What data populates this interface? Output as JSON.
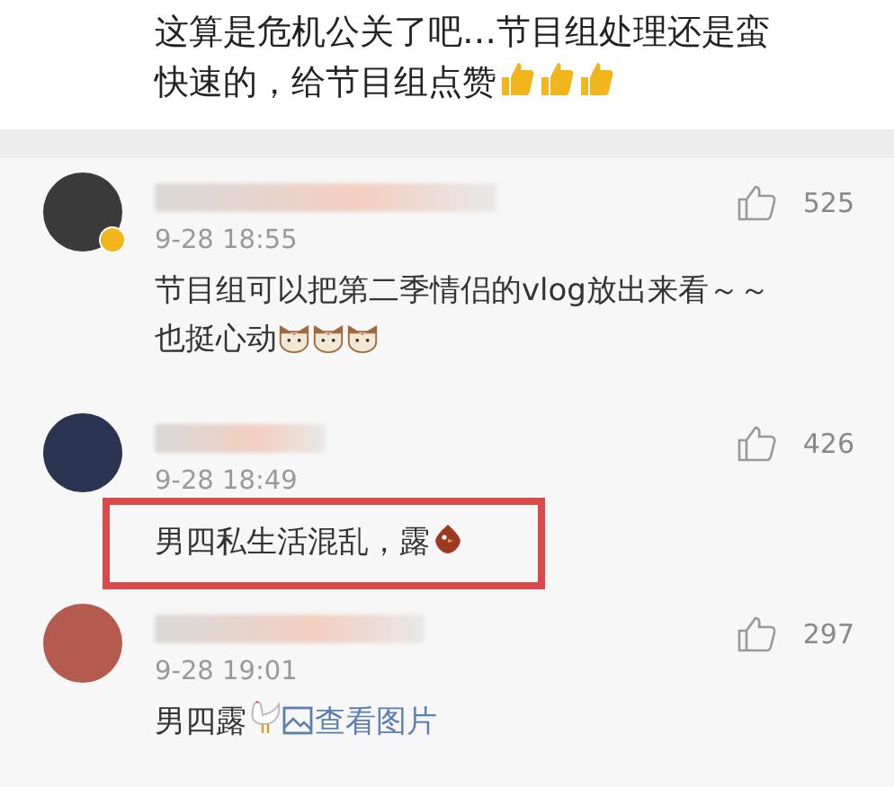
{
  "post": {
    "parts": [
      {
        "kind": "line",
        "text": "这算是危机公关了吧…节目组处理还是蛮"
      },
      {
        "kind": "text",
        "text": "快速的，给节目组点赞"
      },
      {
        "kind": "thumb"
      },
      {
        "kind": "thumb"
      },
      {
        "kind": "thumb"
      }
    ]
  },
  "comments": [
    {
      "verified": true,
      "highlighted": false,
      "time": "9-28 18:55",
      "likes": "525",
      "parts": [
        {
          "kind": "line",
          "text": "节目组可以把第二季情侣的vlog放出来看～～"
        },
        {
          "kind": "text",
          "text": "也挺心动"
        },
        {
          "kind": "cat"
        },
        {
          "kind": "cat"
        },
        {
          "kind": "cat"
        }
      ]
    },
    {
      "verified": false,
      "highlighted": true,
      "time": "9-28 18:49",
      "likes": "426",
      "parts": [
        {
          "kind": "text",
          "text": "男四私生活混乱，露"
        },
        {
          "kind": "bird"
        }
      ]
    },
    {
      "verified": false,
      "highlighted": false,
      "time": "9-28 19:01",
      "likes": "297",
      "parts": [
        {
          "kind": "text",
          "text": "男四露"
        },
        {
          "kind": "hen"
        },
        {
          "kind": "link",
          "text": "查看图片"
        }
      ]
    }
  ]
}
